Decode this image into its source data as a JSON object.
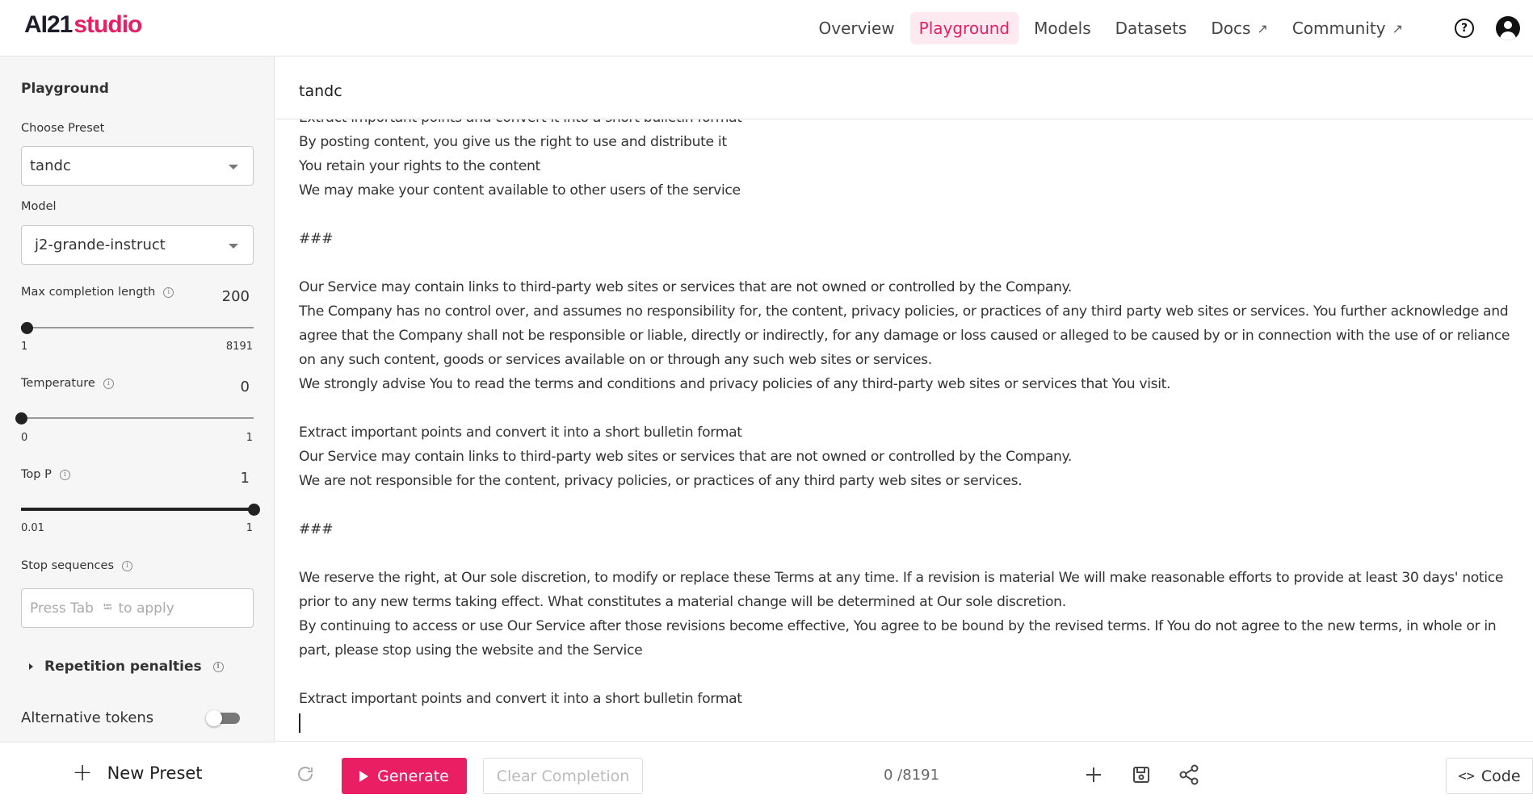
{
  "app": {
    "logo_main": "AI21",
    "logo_sub": "studio"
  },
  "nav": {
    "items": [
      {
        "label": "Overview"
      },
      {
        "label": "Playground"
      },
      {
        "label": "Models"
      },
      {
        "label": "Datasets"
      },
      {
        "label": "Docs"
      },
      {
        "label": "Community"
      }
    ],
    "active": "Playground",
    "help_icon": "question-circle-icon",
    "avatar_icon": "user-avatar-icon"
  },
  "sidebar": {
    "title": "Playground",
    "preset_label": "Choose Preset",
    "preset_value": "tandc",
    "model_label": "Model",
    "model_value": "j2-grande-instruct",
    "max_len": {
      "label": "Max completion length",
      "value": "200",
      "min": "1",
      "max": "8191",
      "level": 0.024
    },
    "temperature": {
      "label": "Temperature",
      "value": "0",
      "min": "0",
      "max": "1",
      "level": 0.0
    },
    "top_p": {
      "label": "Top P",
      "value": "1",
      "min": "0.01",
      "max": "1",
      "level": 1.0
    },
    "stop_label": "Stop sequences",
    "stop_placeholder_pre": "Press Tab",
    "stop_placeholder_post": "to apply",
    "repetition_label": "Repetition penalties",
    "alt_tokens_label": "Alternative tokens",
    "alt_tokens_on": false,
    "new_preset_label": "New Preset"
  },
  "main": {
    "preset_title": "tandc",
    "prompt_text": "Extract important points and convert it into a short bulletin format\nBy posting content, you give us the right to use and distribute it\nYou retain your rights to the content\nWe may make your content available to other users of the service\n\n###\n\nOur Service may contain links to third-party web sites or services that are not owned or controlled by the Company.\nThe Company has no control over, and assumes no responsibility for, the content, privacy policies, or practices of any third party web sites or services. You further acknowledge and agree that the Company shall not be responsible or liable, directly or indirectly, for any damage or loss caused or alleged to be caused by or in connection with the use of or reliance on any such content, goods or services available on or through any such web sites or services.\nWe strongly advise You to read the terms and conditions and privacy policies of any third-party web sites or services that You visit.\n\nExtract important points and convert it into a short bulletin format\nOur Service may contain links to third-party web sites or services that are not owned or controlled by the Company.\nWe are not responsible for the content, privacy policies, or practices of any third party web sites or services.\n\n###\n\nWe reserve the right, at Our sole discretion, to modify or replace these Terms at any time. If a revision is material We will make reasonable efforts to provide at least 30 days' notice prior to any new terms taking effect. What constitutes a material change will be determined at Our sole discretion.\nBy continuing to access or use Our Service after those revisions become effective, You agree to be bound by the revised terms. If You do not agree to the new terms, in whole or in part, please stop using the website and the Service\n\nExtract important points and convert it into a short bulletin format\n"
  },
  "bottom": {
    "generate_label": "Generate",
    "clear_label": "Clear Completion",
    "token_count": "0 /8191",
    "code_label": "Code",
    "code_glyph": "<>"
  },
  "colors": {
    "accent": "#e91e63",
    "accent_bg": "#fde9f0"
  }
}
